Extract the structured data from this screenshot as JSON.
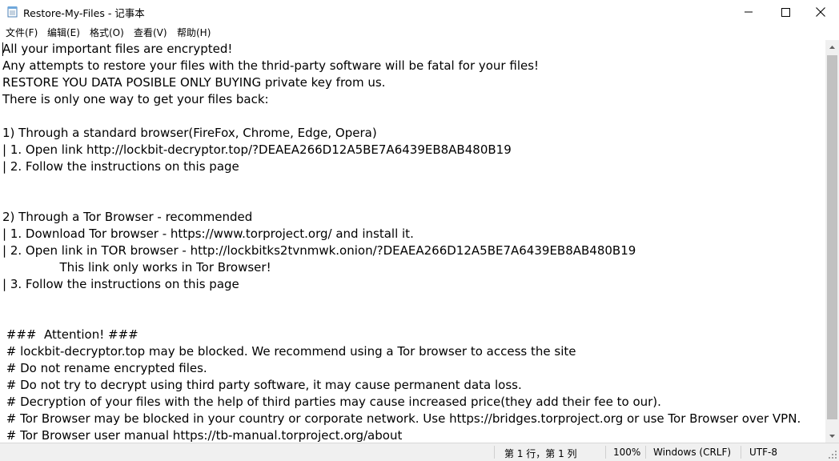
{
  "window": {
    "title": "Restore-My-Files - 记事本",
    "icon": "notepad-icon",
    "controls": {
      "minimize_icon": "minimize-icon",
      "maximize_icon": "maximize-icon",
      "close_icon": "close-icon"
    }
  },
  "menu": {
    "items": [
      {
        "label": "文件(F)"
      },
      {
        "label": "编辑(E)"
      },
      {
        "label": "格式(O)"
      },
      {
        "label": "查看(V)"
      },
      {
        "label": "帮助(H)"
      }
    ]
  },
  "editor": {
    "content": "All your important files are encrypted!\nAny attempts to restore your files with the thrid-party software will be fatal for your files!\nRESTORE YOU DATA POSIBLE ONLY BUYING private key from us.\nThere is only one way to get your files back:\n\n1) Through a standard browser(FireFox, Chrome, Edge, Opera)\n| 1. Open link http://lockbit-decryptor.top/?DEAEA266D12A5BE7A6439EB8AB480B19\n| 2. Follow the instructions on this page\n\n\n2) Through a Tor Browser - recommended\n| 1. Download Tor browser - https://www.torproject.org/ and install it.\n| 2. Open link in TOR browser - http://lockbitks2tvnmwk.onion/?DEAEA266D12A5BE7A6439EB8AB480B19\n               This link only works in Tor Browser!\n| 3. Follow the instructions on this page\n\n\n ###  Attention! ###\n # lockbit-decryptor.top may be blocked. We recommend using a Tor browser to access the site\n # Do not rename encrypted files.\n # Do not try to decrypt using third party software, it may cause permanent data loss.\n # Decryption of your files with the help of third parties may cause increased price(they add their fee to our).\n # Tor Browser may be blocked in your country or corporate network. Use https://bridges.torproject.org or use Tor Browser over VPN.\n # Tor Browser user manual https://tb-manual.torproject.org/about"
  },
  "statusbar": {
    "position": "第 1 行，第 1 列",
    "zoom": "100%",
    "line_ending": "Windows (CRLF)",
    "encoding": "UTF-8"
  },
  "colors": {
    "window_bg": "#ffffff",
    "statusbar_bg": "#f0f0f0",
    "scrollbar_thumb": "#c1c1c1",
    "text": "#000000"
  }
}
